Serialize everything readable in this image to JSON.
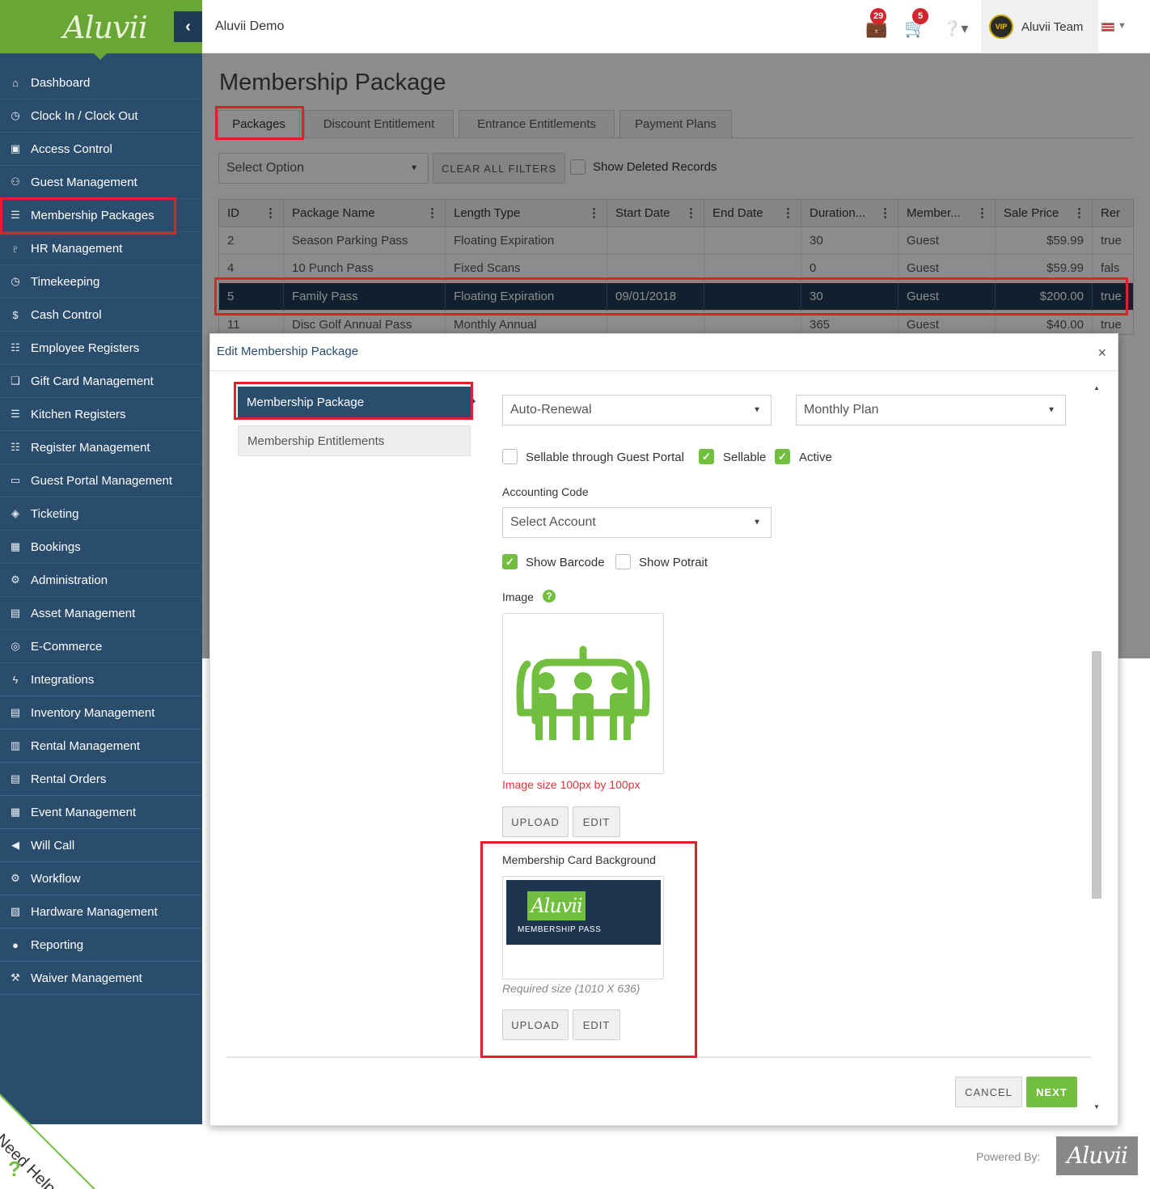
{
  "app": {
    "brand": "Aluvii",
    "org_name": "Aluvii Demo",
    "user_name": "Aluvii Team",
    "vip_label": "VIP",
    "notif_count": "29",
    "cart_count": "5",
    "collapse_icon": "chevron-left-icon"
  },
  "sidebar": {
    "items": [
      {
        "label": "Dashboard",
        "icon": "home-icon"
      },
      {
        "label": "Clock In / Clock Out",
        "icon": "clock-icon"
      },
      {
        "label": "Access Control",
        "icon": "lock-icon"
      },
      {
        "label": "Guest Management",
        "icon": "users-icon"
      },
      {
        "label": "Membership Packages",
        "icon": "list-icon"
      },
      {
        "label": "HR Management",
        "icon": "glass-icon"
      },
      {
        "label": "Timekeeping",
        "icon": "clock-icon"
      },
      {
        "label": "Cash Control",
        "icon": "dollar-icon"
      },
      {
        "label": "Employee Registers",
        "icon": "cart-icon"
      },
      {
        "label": "Gift Card Management",
        "icon": "gift-icon"
      },
      {
        "label": "Kitchen Registers",
        "icon": "list-icon"
      },
      {
        "label": "Register Management",
        "icon": "cart-icon"
      },
      {
        "label": "Guest Portal Management",
        "icon": "laptop-icon"
      },
      {
        "label": "Ticketing",
        "icon": "ticket-icon"
      },
      {
        "label": "Bookings",
        "icon": "calendar-icon"
      },
      {
        "label": "Administration",
        "icon": "gears-icon"
      },
      {
        "label": "Asset Management",
        "icon": "cubes-icon"
      },
      {
        "label": "E-Commerce",
        "icon": "globe-icon"
      },
      {
        "label": "Integrations",
        "icon": "bolt-icon"
      },
      {
        "label": "Inventory Management",
        "icon": "archive-icon"
      },
      {
        "label": "Rental Management",
        "icon": "clipboard-icon"
      },
      {
        "label": "Rental Orders",
        "icon": "file-icon"
      },
      {
        "label": "Event Management",
        "icon": "calendar-check-icon"
      },
      {
        "label": "Will Call",
        "icon": "bullhorn-icon"
      },
      {
        "label": "Workflow",
        "icon": "cog-icon"
      },
      {
        "label": "Hardware Management",
        "icon": "print-icon"
      },
      {
        "label": "Reporting",
        "icon": "lightbulb-icon"
      },
      {
        "label": "Waiver Management",
        "icon": "gavel-icon"
      }
    ]
  },
  "page": {
    "title": "Membership Package",
    "tabs": [
      "Packages",
      "Discount Entitlement",
      "Entrance Entitlements",
      "Payment Plans"
    ],
    "filter_select": "Select Option",
    "clear_filters": "CLEAR ALL FILTERS",
    "show_deleted": "Show Deleted Records"
  },
  "grid": {
    "columns": [
      "ID",
      "Package Name",
      "Length Type",
      "Start Date",
      "End Date",
      "Duration...",
      "Member...",
      "Sale Price",
      "Rer"
    ],
    "rows": [
      {
        "id": "2",
        "name": "Season Parking Pass",
        "length": "Floating Expiration",
        "start": "",
        "end": "",
        "duration": "30",
        "member": "Guest",
        "price": "$59.99",
        "rer": "true"
      },
      {
        "id": "4",
        "name": "10 Punch Pass",
        "length": "Fixed Scans",
        "start": "",
        "end": "",
        "duration": "0",
        "member": "Guest",
        "price": "$59.99",
        "rer": "fals"
      },
      {
        "id": "5",
        "name": "Family Pass",
        "length": "Floating Expiration",
        "start": "09/01/2018",
        "end": "",
        "duration": "30",
        "member": "Guest",
        "price": "$200.00",
        "rer": "true"
      },
      {
        "id": "11",
        "name": "Disc Golf Annual Pass",
        "length": "Monthly Annual",
        "start": "",
        "end": "",
        "duration": "365",
        "member": "Guest",
        "price": "$40.00",
        "rer": "true"
      }
    ]
  },
  "modal": {
    "title": "Edit Membership Package",
    "close": "×",
    "side_tabs": [
      "Membership Package",
      "Membership Entitlements"
    ],
    "renewal_select": "Auto-Renewal",
    "plan_select": "Monthly Plan",
    "sellable_portal": "Sellable through Guest Portal",
    "sellable": "Sellable",
    "active": "Active",
    "accounting_label": "Accounting Code",
    "account_select": "Select Account",
    "show_barcode": "Show Barcode",
    "show_portrait": "Show Potrait",
    "image_label": "Image",
    "image_hint": "Image size 100px by 100px",
    "upload": "UPLOAD",
    "edit": "EDIT",
    "card_bg_label": "Membership Card Background",
    "card_brand": "Aluvii",
    "card_caption": "MEMBERSHIP PASS",
    "card_hint": "Required size (1010 X 636)",
    "cancel": "CANCEL",
    "next": "NEXT"
  },
  "footer": {
    "powered_by": "Powered By:",
    "brand": "Aluvii",
    "need_help": "Need Help",
    "need_help_mark": "?"
  },
  "colors": {
    "sidebar": "#2a4d6e",
    "accent_green": "#72bf3f",
    "highlight_red": "#e0202c",
    "selected_row": "#1f3b56"
  }
}
